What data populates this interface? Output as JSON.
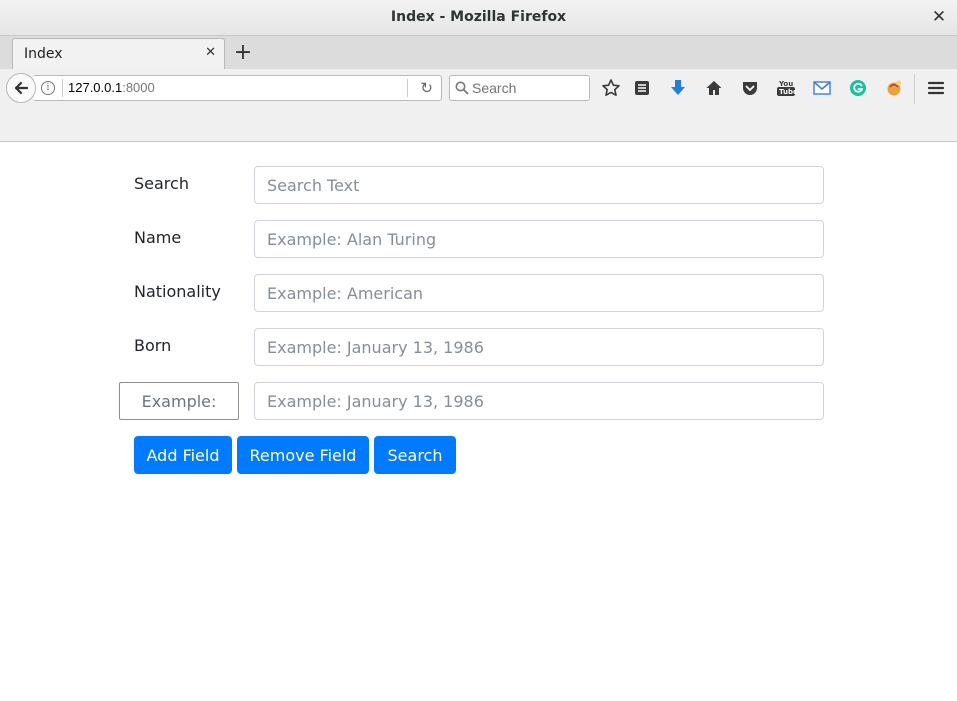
{
  "window": {
    "title": "Index - Mozilla Firefox"
  },
  "tabs": [
    {
      "label": "Index"
    }
  ],
  "toolbar": {
    "url_host": "127.0.0.1",
    "url_port": ":8000",
    "search_placeholder": "Search",
    "icons": [
      "back-icon",
      "info-icon",
      "reload-icon",
      "search-icon",
      "bookmark-star-icon",
      "reading-list-icon",
      "download-icon",
      "home-icon",
      "pocket-icon",
      "youtube-icon",
      "gmail-icon",
      "grammarly-icon",
      "extension-icon",
      "menu-icon"
    ],
    "accent_download": "#1f7ee0"
  },
  "form": {
    "fields": [
      {
        "label": "Search",
        "placeholder": "Search Text"
      },
      {
        "label": "Name",
        "placeholder": "Example: Alan Turing"
      },
      {
        "label": "Nationality",
        "placeholder": "Example: American"
      },
      {
        "label": "Born",
        "placeholder": "Example: January 13, 1986"
      }
    ],
    "custom_field": {
      "key_placeholder": "Example:",
      "value_placeholder": "Example: January 13, 1986"
    },
    "buttons": {
      "add": "Add Field",
      "remove": "Remove Field",
      "search": "Search"
    },
    "button_color": "#007bff"
  }
}
